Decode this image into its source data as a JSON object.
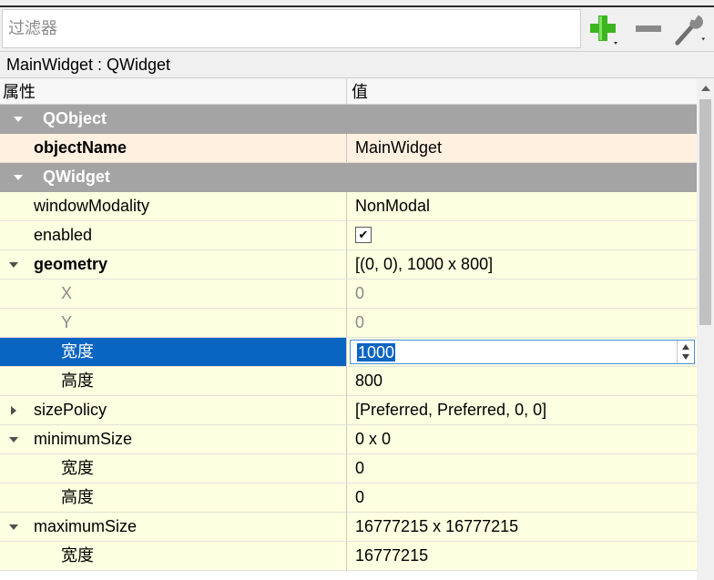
{
  "filter": {
    "placeholder": "过滤器"
  },
  "toolbar": {
    "add": "add-icon",
    "remove": "remove-icon",
    "configure": "wrench-icon"
  },
  "class_label": "MainWidget : QWidget",
  "header": {
    "property": "属性",
    "value": "值"
  },
  "rows": [
    {
      "type": "section",
      "name": "QObject"
    },
    {
      "type": "prop",
      "name": "objectName",
      "value": "MainWidget",
      "bold": true,
      "changed": true
    },
    {
      "type": "section",
      "name": "QWidget"
    },
    {
      "type": "prop",
      "name": "windowModality",
      "value": "NonModal"
    },
    {
      "type": "prop",
      "name": "enabled",
      "value": "✔",
      "checkbox": true,
      "checked": true
    },
    {
      "type": "prop",
      "name": "geometry",
      "value": "[(0, 0), 1000 x 800]",
      "bold": true,
      "expanded": true
    },
    {
      "type": "sub",
      "name": "X",
      "value": "0",
      "disabled": true
    },
    {
      "type": "sub",
      "name": "Y",
      "value": "0",
      "disabled": true
    },
    {
      "type": "sub",
      "name": "宽度",
      "value": "1000",
      "selected": true,
      "editing": true
    },
    {
      "type": "sub",
      "name": "高度",
      "value": "800"
    },
    {
      "type": "prop",
      "name": "sizePolicy",
      "value": "[Preferred, Preferred, 0, 0]",
      "collapsed": true
    },
    {
      "type": "prop",
      "name": "minimumSize",
      "value": "0 x 0",
      "expanded": true
    },
    {
      "type": "sub",
      "name": "宽度",
      "value": "0"
    },
    {
      "type": "sub",
      "name": "高度",
      "value": "0"
    },
    {
      "type": "prop",
      "name": "maximumSize",
      "value": "16777215 x 16777215",
      "expanded": true
    },
    {
      "type": "sub",
      "name": "宽度",
      "value": "16777215"
    }
  ],
  "colors": {
    "section_bg": "#a4a4a4",
    "row_bg": "#ffffe1",
    "changed_bg": "#fff0e0",
    "selection": "#0a64c2",
    "add_green": "#3cb521"
  }
}
